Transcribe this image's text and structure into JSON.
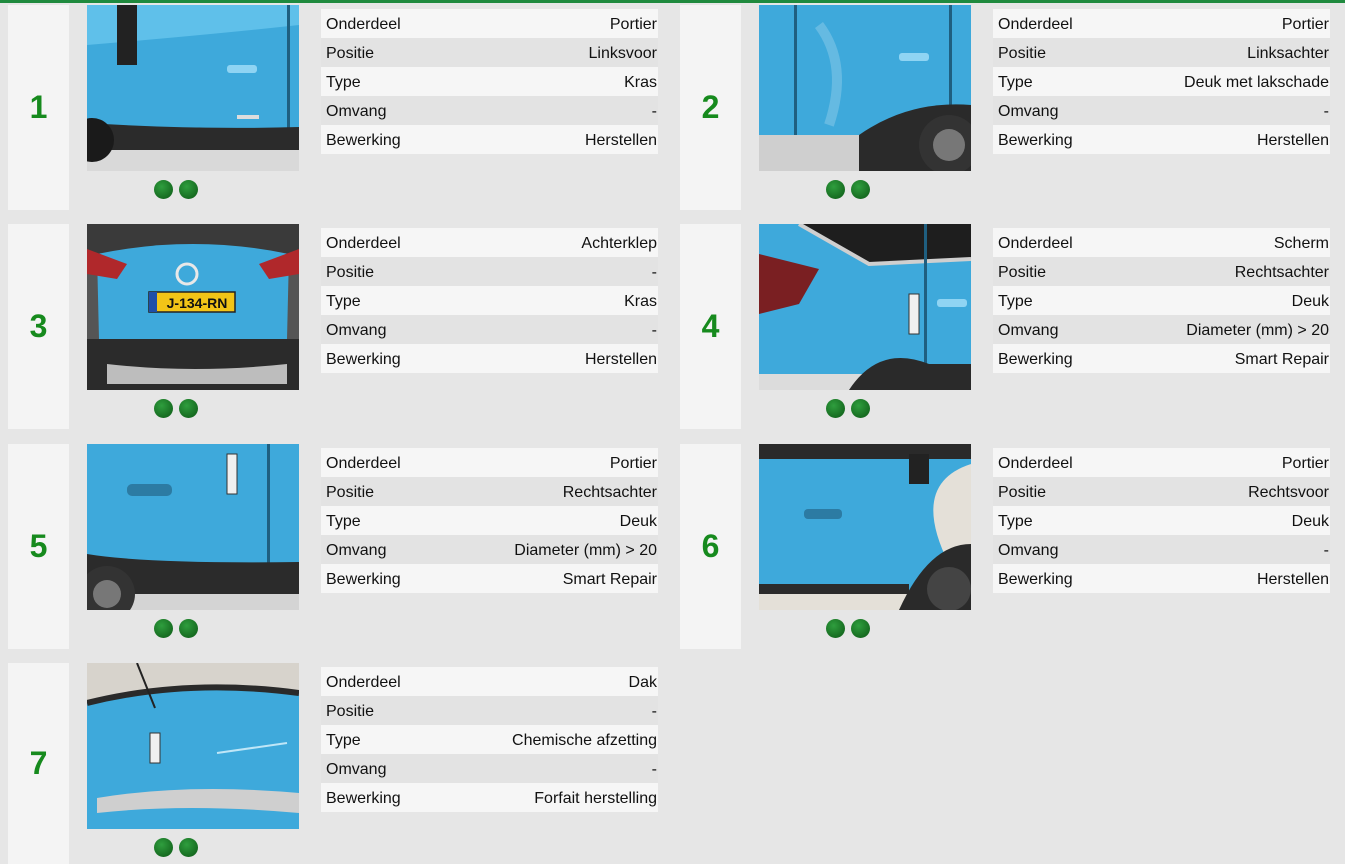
{
  "items": [
    {
      "number": "1",
      "rows": [
        [
          "Onderdeel",
          "Portier"
        ],
        [
          "Positie",
          "Linksvoor"
        ],
        [
          "Type",
          "Kras"
        ],
        [
          "Omvang",
          "-"
        ],
        [
          "Bewerking",
          "Herstellen"
        ]
      ],
      "photo": "door-front-left"
    },
    {
      "number": "2",
      "rows": [
        [
          "Onderdeel",
          "Portier"
        ],
        [
          "Positie",
          "Linksachter"
        ],
        [
          "Type",
          "Deuk met lakschade"
        ],
        [
          "Omvang",
          "-"
        ],
        [
          "Bewerking",
          "Herstellen"
        ]
      ],
      "photo": "door-rear-left"
    },
    {
      "number": "3",
      "rows": [
        [
          "Onderdeel",
          "Achterklep"
        ],
        [
          "Positie",
          "-"
        ],
        [
          "Type",
          "Kras"
        ],
        [
          "Omvang",
          "-"
        ],
        [
          "Bewerking",
          "Herstellen"
        ]
      ],
      "photo": "tailgate",
      "plate": "J-134-RN"
    },
    {
      "number": "4",
      "rows": [
        [
          "Onderdeel",
          "Scherm"
        ],
        [
          "Positie",
          "Rechtsachter"
        ],
        [
          "Type",
          "Deuk"
        ],
        [
          "Omvang",
          "Diameter (mm) > 20"
        ],
        [
          "Bewerking",
          "Smart Repair"
        ]
      ],
      "photo": "fender-rear-right"
    },
    {
      "number": "5",
      "rows": [
        [
          "Onderdeel",
          "Portier"
        ],
        [
          "Positie",
          "Rechtsachter"
        ],
        [
          "Type",
          "Deuk"
        ],
        [
          "Omvang",
          "Diameter (mm) > 20"
        ],
        [
          "Bewerking",
          "Smart Repair"
        ]
      ],
      "photo": "door-rear-right"
    },
    {
      "number": "6",
      "rows": [
        [
          "Onderdeel",
          "Portier"
        ],
        [
          "Positie",
          "Rechtsvoor"
        ],
        [
          "Type",
          "Deuk"
        ],
        [
          "Omvang",
          "-"
        ],
        [
          "Bewerking",
          "Herstellen"
        ]
      ],
      "photo": "door-front-right"
    },
    {
      "number": "7",
      "rows": [
        [
          "Onderdeel",
          "Dak"
        ],
        [
          "Positie",
          "-"
        ],
        [
          "Type",
          "Chemische afzetting"
        ],
        [
          "Omvang",
          "-"
        ],
        [
          "Bewerking",
          "Forfait herstelling"
        ]
      ],
      "photo": "roof"
    }
  ],
  "colors": {
    "accent": "#168a1d",
    "car_blue": "#3fa7d8",
    "topbar": "#1f8a3e"
  }
}
